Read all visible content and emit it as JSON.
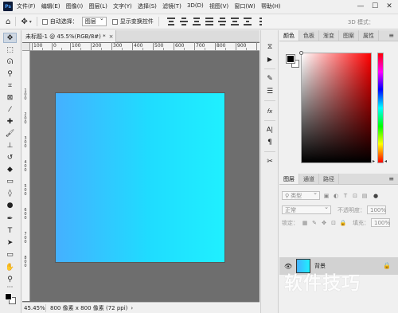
{
  "app": {
    "logo": "Ps",
    "menu": [
      "文件(F)",
      "编辑(E)",
      "图像(I)",
      "图层(L)",
      "文字(Y)",
      "选择(S)",
      "滤镜(T)",
      "3D(D)",
      "视图(V)",
      "窗口(W)",
      "帮助(H)"
    ],
    "window_controls": [
      "—",
      "☐",
      "✕"
    ]
  },
  "options": {
    "home_icon": "home-icon",
    "move_icon": "move-icon",
    "auto_select_label": "自动选择：",
    "auto_select_target": "图层",
    "show_transform_label": "显示变换控件",
    "mode_3d": "3D 模式："
  },
  "document": {
    "tab_title": "未标题-1 @ 45.5%(RGB/8#) *",
    "tab_close": "×",
    "ruler_top": [
      "100",
      "0",
      "100",
      "200",
      "300",
      "400",
      "500",
      "600",
      "700",
      "800",
      "900"
    ],
    "ruler_left": [
      "1",
      "0",
      "0",
      "2",
      "0",
      "0",
      "3",
      "0",
      "0",
      "4",
      "0",
      "0",
      "5",
      "0",
      "0",
      "6",
      "0",
      "0",
      "7",
      "0",
      "0",
      "8",
      "0",
      "0"
    ],
    "canvas_colors": [
      "#45b0ff",
      "#1ff0ff"
    ],
    "zoom": "45.45%",
    "doc_info": "800 像素 x 800 像素 (72 ppi)",
    "status_arrow": "›"
  },
  "tools": [
    {
      "name": "move-tool",
      "glyph": "✥"
    },
    {
      "name": "marquee-tool",
      "glyph": "⬚"
    },
    {
      "name": "lasso-tool",
      "glyph": "ᘏ"
    },
    {
      "name": "magic-wand-tool",
      "glyph": "⚲"
    },
    {
      "name": "crop-tool",
      "glyph": "⌗"
    },
    {
      "name": "frame-tool",
      "glyph": "⊠"
    },
    {
      "name": "eyedropper-tool",
      "glyph": "⁄"
    },
    {
      "name": "healing-brush-tool",
      "glyph": "✚"
    },
    {
      "name": "brush-tool",
      "glyph": "🖌"
    },
    {
      "name": "clone-stamp-tool",
      "glyph": "⊥"
    },
    {
      "name": "history-brush-tool",
      "glyph": "↺"
    },
    {
      "name": "eraser-tool",
      "glyph": "◆"
    },
    {
      "name": "gradient-tool",
      "glyph": "▭"
    },
    {
      "name": "blur-tool",
      "glyph": "◊"
    },
    {
      "name": "dodge-tool",
      "glyph": "●"
    },
    {
      "name": "pen-tool",
      "glyph": "✒"
    },
    {
      "name": "type-tool",
      "glyph": "T"
    },
    {
      "name": "path-selection-tool",
      "glyph": "➤"
    },
    {
      "name": "rectangle-tool",
      "glyph": "▭"
    },
    {
      "name": "hand-tool",
      "glyph": "✋"
    },
    {
      "name": "zoom-tool",
      "glyph": "⚲"
    },
    {
      "name": "more-tools",
      "glyph": "···"
    }
  ],
  "mid_strip": [
    {
      "name": "history-icon",
      "glyph": "⧖"
    },
    {
      "name": "actions-play-icon",
      "glyph": "▶"
    },
    {
      "name": "brush-settings-icon",
      "glyph": "✎"
    },
    {
      "name": "adjustments-icon",
      "glyph": "☰"
    },
    {
      "name": "fx-icon",
      "glyph": "fx"
    },
    {
      "name": "character-icon",
      "glyph": "A|"
    },
    {
      "name": "paragraph-icon",
      "glyph": "¶"
    },
    {
      "name": "tools-icon",
      "glyph": "✂"
    }
  ],
  "color_panel": {
    "tabs": [
      "颜色",
      "色板",
      "渐变",
      "图案",
      "属性"
    ],
    "menu": "≡"
  },
  "layers_panel": {
    "tabs": [
      "图层",
      "通道",
      "路径"
    ],
    "menu": "≡",
    "filter_label": "类型",
    "blend_mode": "正常",
    "opacity_label": "不透明度：",
    "opacity_value": "100%",
    "lock_label": "锁定：",
    "fill_label": "填充：",
    "fill_value": "100%",
    "layer_name": "背景"
  },
  "watermark": "软件技巧",
  "colors": {
    "canvas_left": "#45b0ff",
    "canvas_right": "#1ff0ff",
    "workspace": "#6e6e6e",
    "panel_bg": "#f0f0f0"
  }
}
